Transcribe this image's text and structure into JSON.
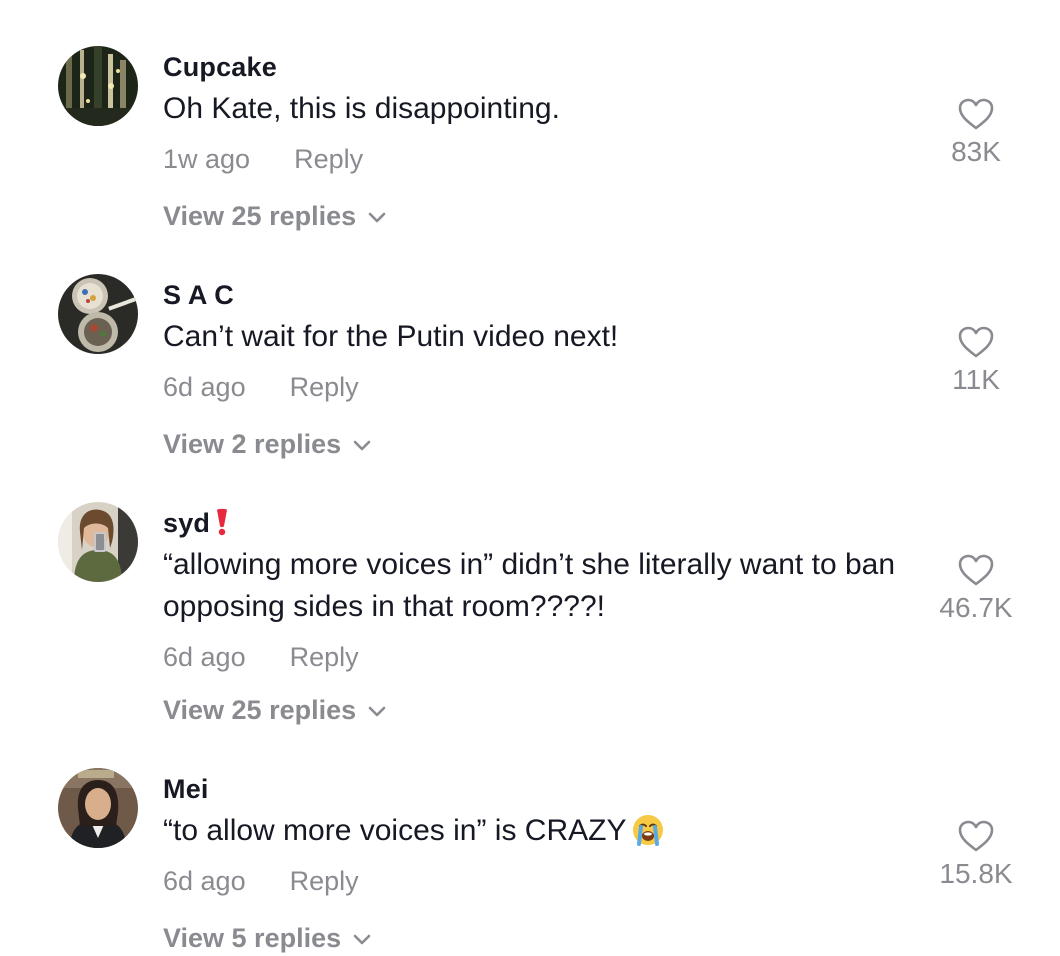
{
  "comments": [
    {
      "username": "Cupcake",
      "text": "Oh Kate, this is disappointing.",
      "time": "1w ago",
      "reply_label": "Reply",
      "view_replies": "View 25 replies",
      "likes": "83K"
    },
    {
      "username": "S A C",
      "text": "Can’t wait for the Putin video next!",
      "time": "6d ago",
      "reply_label": "Reply",
      "view_replies": "View 2 replies",
      "likes": "11K"
    },
    {
      "username": "syd",
      "username_badge": "heavy-exclamation-emoji",
      "text": "“allowing more voices in” didn’t she literally want to ban opposing sides in that room????!",
      "time": "6d ago",
      "reply_label": "Reply",
      "view_replies": "View 25 replies",
      "likes": "46.7K"
    },
    {
      "username": "Mei",
      "text": "“to allow more voices in” is CRAZY",
      "text_emoji": "loudly-crying-face-emoji",
      "time": "6d ago",
      "reply_label": "Reply",
      "view_replies": "View 5 replies",
      "likes": "15.8K"
    }
  ],
  "icons": {
    "like": "heart-outline-icon",
    "expand": "chevron-down-icon"
  },
  "colors": {
    "primary_text": "#161823",
    "secondary_text": "#8a8b91",
    "badge_red": "#e8283c",
    "emoji_yellow": "#f7c944",
    "emoji_tear": "#5aa9e6"
  }
}
